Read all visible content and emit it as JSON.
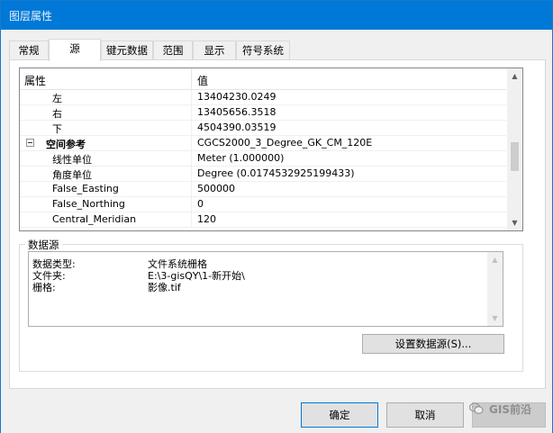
{
  "window": {
    "title": "图层属性"
  },
  "tabs": [
    {
      "label": "常规"
    },
    {
      "label": "源"
    },
    {
      "label": "键元数据"
    },
    {
      "label": "范围"
    },
    {
      "label": "显示"
    },
    {
      "label": "符号系统"
    }
  ],
  "active_tab": "源",
  "property_grid": {
    "header": {
      "property": "属性",
      "value": "值"
    },
    "rows": [
      {
        "key": "左",
        "value": "13404230.0249"
      },
      {
        "key": "右",
        "value": "13405656.3518"
      },
      {
        "key": "下",
        "value": "4504390.03519"
      },
      {
        "key": "空间参考",
        "value": "CGCS2000_3_Degree_GK_CM_120E"
      },
      {
        "key": "线性单位",
        "value": "Meter (1.000000)"
      },
      {
        "key": "角度单位",
        "value": "Degree (0.0174532925199433)"
      },
      {
        "key": "False_Easting",
        "value": "500000"
      },
      {
        "key": "False_Northing",
        "value": "0"
      },
      {
        "key": "Central_Meridian",
        "value": "120"
      }
    ]
  },
  "data_source": {
    "legend": "数据源",
    "lines": [
      {
        "label": "数据类型:",
        "value": "文件系统栅格"
      },
      {
        "label": "文件夹:",
        "value": "E:\\3-gisQY\\1-新开始\\"
      },
      {
        "label": "栅格:",
        "value": "影像.tif"
      }
    ],
    "set_button": "设置数据源(S)..."
  },
  "footer": {
    "ok": "确定",
    "cancel": "取消",
    "watermark": "GIS前沿"
  }
}
